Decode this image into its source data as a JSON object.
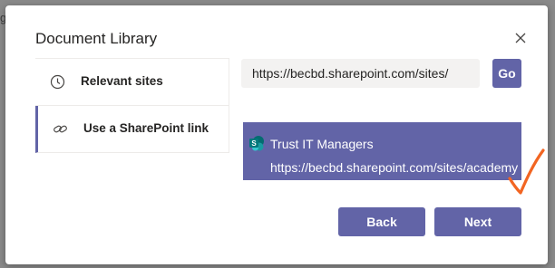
{
  "backdrop": {
    "partial_text": "g"
  },
  "dialog": {
    "title": "Document Library",
    "close_icon": "close-icon"
  },
  "nav": {
    "items": [
      {
        "label": "Relevant sites",
        "icon": "clock-icon",
        "selected": false
      },
      {
        "label": "Use a SharePoint link",
        "icon": "link-icon",
        "selected": true
      }
    ]
  },
  "link_form": {
    "url_value": "https://becbd.sharepoint.com/sites/",
    "go_label": "Go"
  },
  "result": {
    "icon": "sharepoint-icon",
    "name": "Trust IT Managers",
    "url": "https://becbd.sharepoint.com/sites/academy"
  },
  "annotation": {
    "icon": "checkmark-annotation-icon",
    "color": "#f26522"
  },
  "footer": {
    "back_label": "Back",
    "next_label": "Next"
  },
  "colors": {
    "accent": "#6264a7",
    "input_bg": "#f3f2f1",
    "backdrop": "#8a8a8a"
  }
}
